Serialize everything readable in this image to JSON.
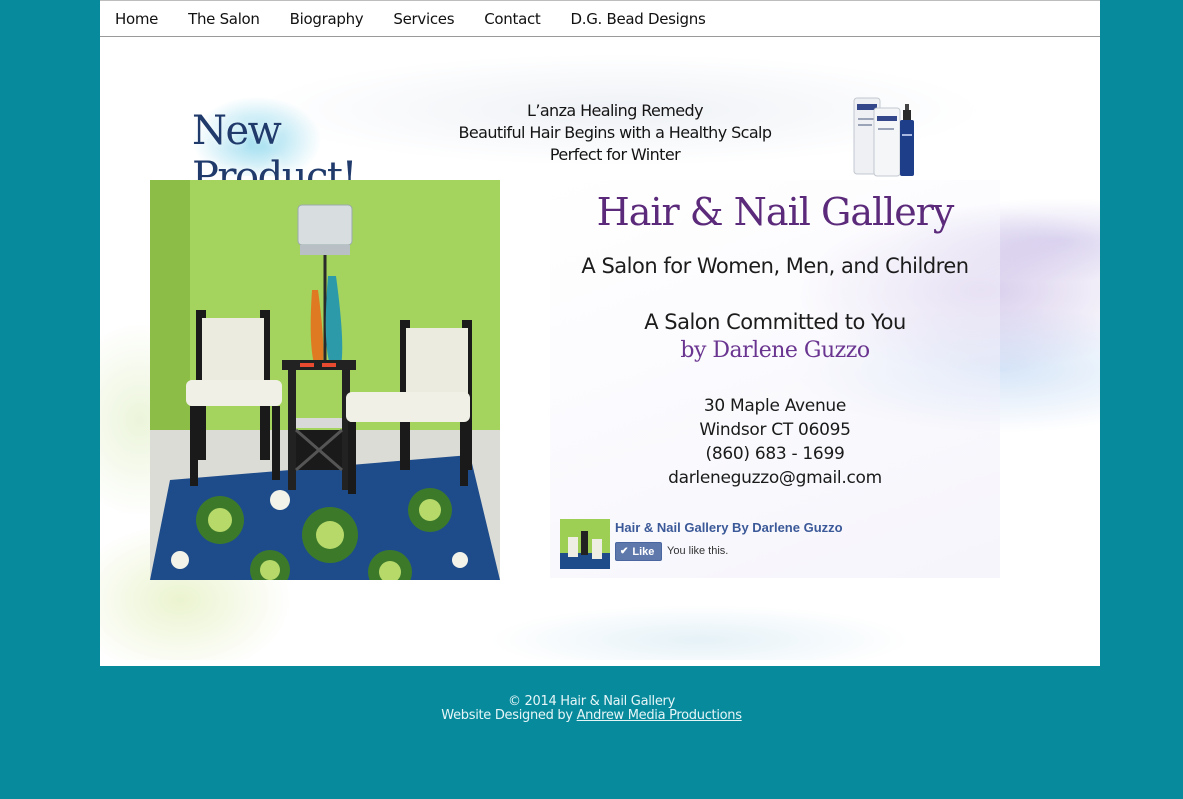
{
  "nav": {
    "items": [
      "Home",
      "The Salon",
      "Biography",
      "Services",
      "Contact",
      "D.G. Bead Designs"
    ]
  },
  "banner": {
    "title": "New Product!",
    "line1": "L’anza Healing Remedy",
    "line2": "Beautiful Hair Begins with a Healthy Scalp",
    "line3": "Perfect for Winter"
  },
  "info": {
    "salon_name": "Hair & Nail Gallery",
    "tagline": "A Salon for Women, Men, and Children",
    "committed": "A Salon Committed to You",
    "byline": "by Darlene Guzzo",
    "address_street": "30 Maple Avenue",
    "address_city": "Windsor CT 06095",
    "phone": "(860) 683 - 1699",
    "email": "darleneguzzo@gmail.com"
  },
  "facebook": {
    "page_name": "Hair & Nail Gallery By Darlene Guzzo",
    "like_label": "Like",
    "status": "You like this."
  },
  "footer": {
    "copyright": "© 2014 Hair & Nail Gallery",
    "designed_by": "Website Designed by",
    "designer_link": "Andrew Media Productions"
  },
  "colors": {
    "page_bg": "#078a9c",
    "salon_name": "#5c2a7a",
    "banner_title": "#1f3a6b",
    "facebook_blue": "#3b5998"
  }
}
